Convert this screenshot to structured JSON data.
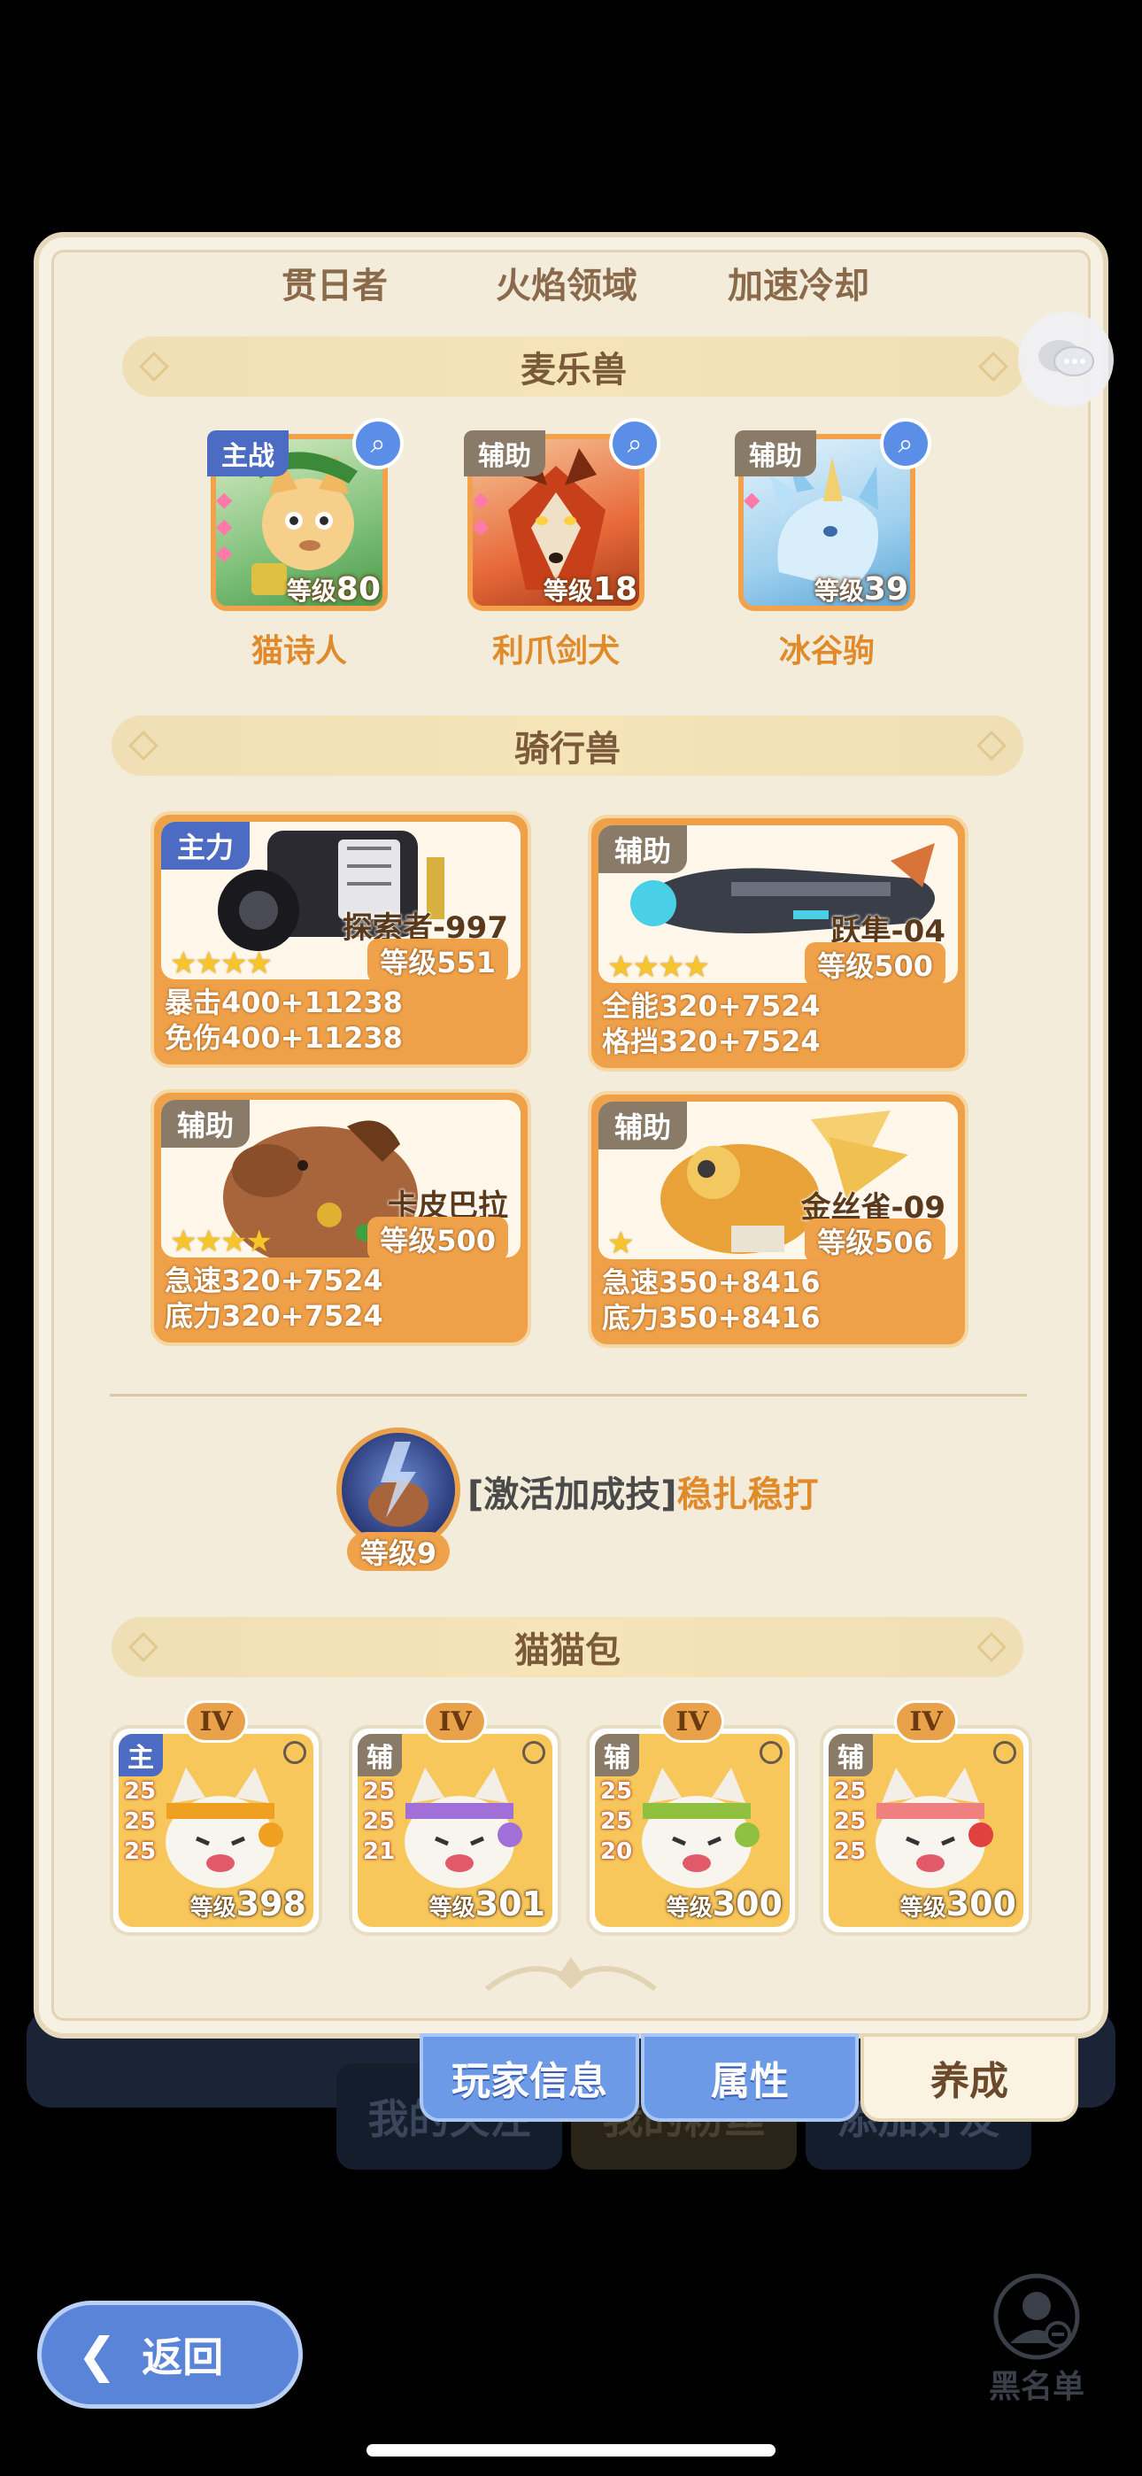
{
  "top_skills": [
    "贯日者",
    "火焰领域",
    "加速冷却"
  ],
  "sections": {
    "pets_title": "麦乐兽",
    "mounts_title": "骑行兽",
    "bags_title": "猫猫包"
  },
  "pets": [
    {
      "role": "主战",
      "level_prefix": "等级",
      "level": "80",
      "name": "猫诗人"
    },
    {
      "role": "辅助",
      "level_prefix": "等级",
      "level": "18",
      "name": "利爪剑犬"
    },
    {
      "role": "辅助",
      "level_prefix": "等级",
      "level": "39",
      "name": "冰谷驹"
    }
  ],
  "mounts": [
    {
      "role": "主力",
      "name": "探索者-997",
      "level": "等级551",
      "stars": "★★★★",
      "stat1": "暴击400+11238",
      "stat2": "免伤400+11238"
    },
    {
      "role": "辅助",
      "name": "跃隼-04",
      "level": "等级500",
      "stars": "★★★★",
      "stat1": "全能320+7524",
      "stat2": "格挡320+7524"
    },
    {
      "role": "辅助",
      "name": "卡皮巴拉",
      "level": "等级500",
      "stars": "★★★★",
      "stat1": "急速320+7524",
      "stat2": "底力320+7524"
    },
    {
      "role": "辅助",
      "name": "金丝雀-09",
      "level": "等级506",
      "stars": "★",
      "stat1": "急速350+8416",
      "stat2": "底力350+8416"
    }
  ],
  "skill": {
    "prefix": "[激活加成技]",
    "name": "稳扎稳打",
    "level": "等级9"
  },
  "bags": [
    {
      "tier": "IV",
      "role": "主",
      "nums": [
        "25",
        "25",
        "25"
      ],
      "level_prefix": "等级",
      "level": "398"
    },
    {
      "tier": "IV",
      "role": "辅",
      "nums": [
        "25",
        "25",
        "21"
      ],
      "level_prefix": "等级",
      "level": "301"
    },
    {
      "tier": "IV",
      "role": "辅",
      "nums": [
        "25",
        "25",
        "20"
      ],
      "level_prefix": "等级",
      "level": "300"
    },
    {
      "tier": "IV",
      "role": "辅",
      "nums": [
        "25",
        "25",
        "25"
      ],
      "level_prefix": "等级",
      "level": "300"
    }
  ],
  "tabs": [
    "玩家信息",
    "属性",
    "养成"
  ],
  "background_tabs": [
    "我的关注",
    "我的粉丝",
    "添加好友"
  ],
  "back_label": "返回",
  "blacklist_label": "黑名单",
  "colors": {
    "panel_bg": "#f3ecdb",
    "accent_orange": "#efa14a",
    "accent_blue": "#6c9ae6",
    "skill_name": "#e08a2a"
  }
}
